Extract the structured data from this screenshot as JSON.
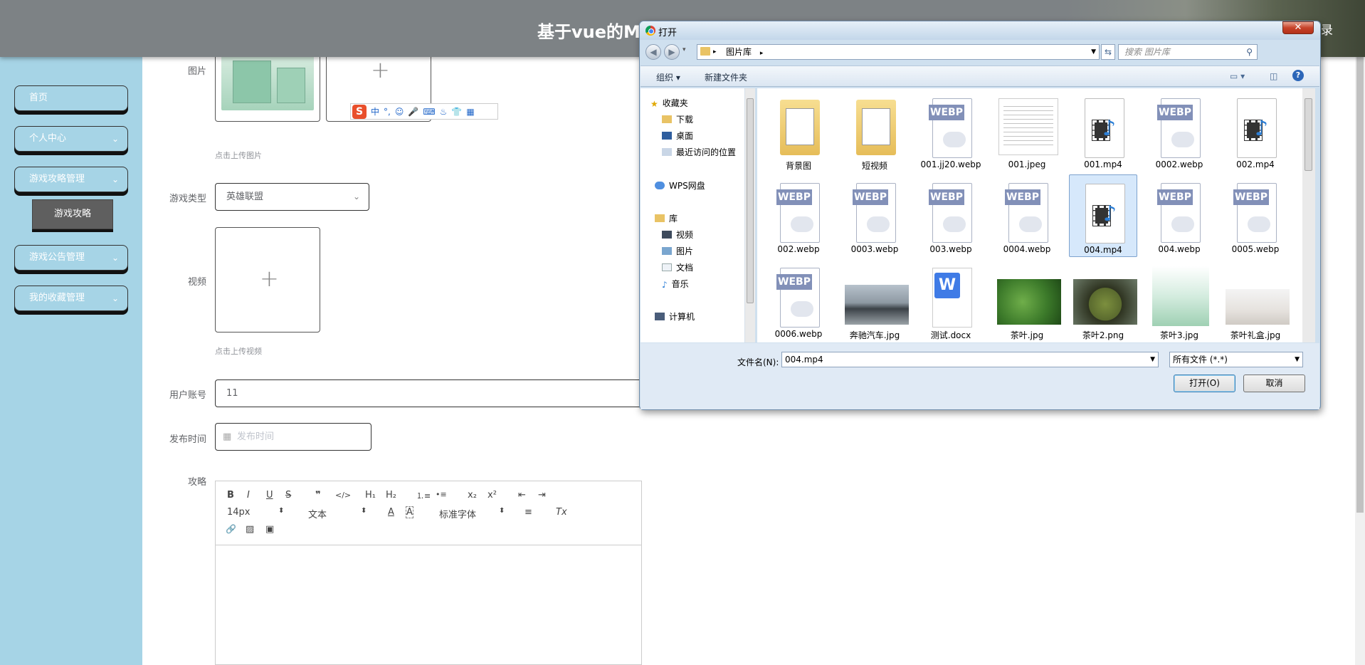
{
  "header": {
    "title": "基于vue的M",
    "logout": "录"
  },
  "sidebar": {
    "items": [
      {
        "label": "首页"
      },
      {
        "label": "个人中心",
        "chev": "⌄"
      },
      {
        "label": "游戏攻略管理",
        "chev": "⌄"
      },
      {
        "label": "游戏公告管理",
        "chev": "⌄"
      },
      {
        "label": "我的收藏管理",
        "chev": "⌄"
      }
    ],
    "submenu": {
      "label": "游戏攻略"
    }
  },
  "form": {
    "image_label": "图片",
    "image_hint": "点击上传图片",
    "game_type_label": "游戏类型",
    "game_type_value": "英雄联盟",
    "video_label": "视频",
    "video_hint": "点击上传视频",
    "account_label": "用户账号",
    "account_value": "11",
    "publish_time_label": "发布时间",
    "publish_time_placeholder": "发布时间",
    "strategy_label": "攻略",
    "plus": "+"
  },
  "ime": {
    "logo": "S",
    "mode": "中",
    "punct": "°,",
    "emoji": "☺",
    "mic": "🎤",
    "keyboard": "⌨",
    "tools": "♨",
    "skin": "👕",
    "grid": "▦"
  },
  "editor": {
    "bold": "B",
    "italic": "I",
    "underline": "U",
    "strike": "S",
    "quote": "❞",
    "code": "</>",
    "h1": "H₁",
    "h2": "H₂",
    "ol": "⒈≡",
    "ul": "•≡",
    "sub": "x₂",
    "sup": "x²",
    "outdent": "⇤",
    "indent": "⇥",
    "size": "14px",
    "block": "文本",
    "font": "标准字体",
    "color": "A",
    "bg": "A",
    "align": "≡",
    "clear": "Tx",
    "link": "🔗",
    "image": "▨",
    "video": "▣"
  },
  "dialog": {
    "title": "打开",
    "close": "✕",
    "path": "图片库",
    "search_placeholder": "搜索 图片库",
    "organize": "组织 ▾",
    "new_folder": "新建文件夹",
    "help": "?",
    "nav": [
      {
        "label": "收藏夹"
      },
      {
        "label": "下载"
      },
      {
        "label": "桌面"
      },
      {
        "label": "最近访问的位置"
      },
      {
        "label": "WPS网盘"
      },
      {
        "label": "库"
      },
      {
        "label": "视频"
      },
      {
        "label": "图片"
      },
      {
        "label": "文档"
      },
      {
        "label": "音乐"
      },
      {
        "label": "计算机"
      }
    ],
    "files": [
      {
        "name": "背景图",
        "kind": "folder"
      },
      {
        "name": "短视频",
        "kind": "folder"
      },
      {
        "name": "001.jj20.webp",
        "kind": "webp"
      },
      {
        "name": "001.jpeg",
        "kind": "doc"
      },
      {
        "name": "001.mp4",
        "kind": "mp4"
      },
      {
        "name": "0002.webp",
        "kind": "webp"
      },
      {
        "name": "002.mp4",
        "kind": "mp4"
      },
      {
        "name": "002.webp",
        "kind": "webp"
      },
      {
        "name": "0003.webp",
        "kind": "webp"
      },
      {
        "name": "003.webp",
        "kind": "webp"
      },
      {
        "name": "0004.webp",
        "kind": "webp"
      },
      {
        "name": "004.mp4",
        "kind": "mp4",
        "selected": true
      },
      {
        "name": "004.webp",
        "kind": "webp"
      },
      {
        "name": "0005.webp",
        "kind": "webp"
      },
      {
        "name": "0006.webp",
        "kind": "webp"
      },
      {
        "name": "奔驰汽车.jpg",
        "kind": "car"
      },
      {
        "name": "测试.docx",
        "kind": "wps"
      },
      {
        "name": "茶叶.jpg",
        "kind": "tea1"
      },
      {
        "name": "茶叶2.png",
        "kind": "tea2"
      },
      {
        "name": "茶叶3.jpg",
        "kind": "tea3"
      },
      {
        "name": "茶叶礼盒.jpg",
        "kind": "tea4"
      }
    ],
    "webp_tag": "WEBP",
    "filename_label": "文件名(N):",
    "filename_value": "004.mp4",
    "filetype_value": "所有文件 (*.*)",
    "open_button": "打开(O)",
    "cancel_button": "取消"
  }
}
